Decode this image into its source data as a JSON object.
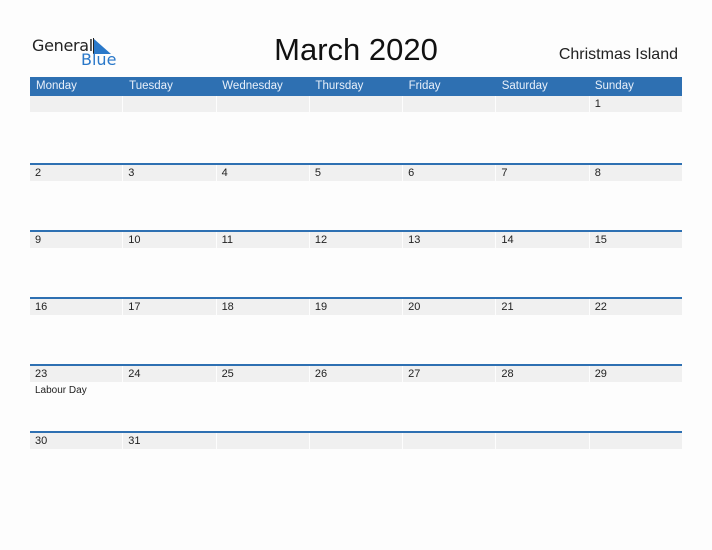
{
  "logo": {
    "line1": "General",
    "line2": "Blue",
    "accent": "#2a78c9"
  },
  "title": "March 2020",
  "country": "Christmas Island",
  "colors": {
    "header_bg": "#2e70b2",
    "band_bg": "#f0f0f0"
  },
  "weekdays": [
    "Monday",
    "Tuesday",
    "Wednesday",
    "Thursday",
    "Friday",
    "Saturday",
    "Sunday"
  ],
  "weeks": [
    {
      "days": [
        {
          "num": "",
          "holiday": ""
        },
        {
          "num": "",
          "holiday": ""
        },
        {
          "num": "",
          "holiday": ""
        },
        {
          "num": "",
          "holiday": ""
        },
        {
          "num": "",
          "holiday": ""
        },
        {
          "num": "",
          "holiday": ""
        },
        {
          "num": "1",
          "holiday": ""
        }
      ]
    },
    {
      "days": [
        {
          "num": "2",
          "holiday": ""
        },
        {
          "num": "3",
          "holiday": ""
        },
        {
          "num": "4",
          "holiday": ""
        },
        {
          "num": "5",
          "holiday": ""
        },
        {
          "num": "6",
          "holiday": ""
        },
        {
          "num": "7",
          "holiday": ""
        },
        {
          "num": "8",
          "holiday": ""
        }
      ]
    },
    {
      "days": [
        {
          "num": "9",
          "holiday": ""
        },
        {
          "num": "10",
          "holiday": ""
        },
        {
          "num": "11",
          "holiday": ""
        },
        {
          "num": "12",
          "holiday": ""
        },
        {
          "num": "13",
          "holiday": ""
        },
        {
          "num": "14",
          "holiday": ""
        },
        {
          "num": "15",
          "holiday": ""
        }
      ]
    },
    {
      "days": [
        {
          "num": "16",
          "holiday": ""
        },
        {
          "num": "17",
          "holiday": ""
        },
        {
          "num": "18",
          "holiday": ""
        },
        {
          "num": "19",
          "holiday": ""
        },
        {
          "num": "20",
          "holiday": ""
        },
        {
          "num": "21",
          "holiday": ""
        },
        {
          "num": "22",
          "holiday": ""
        }
      ]
    },
    {
      "days": [
        {
          "num": "23",
          "holiday": "Labour Day"
        },
        {
          "num": "24",
          "holiday": ""
        },
        {
          "num": "25",
          "holiday": ""
        },
        {
          "num": "26",
          "holiday": ""
        },
        {
          "num": "27",
          "holiday": ""
        },
        {
          "num": "28",
          "holiday": ""
        },
        {
          "num": "29",
          "holiday": ""
        }
      ]
    },
    {
      "days": [
        {
          "num": "30",
          "holiday": ""
        },
        {
          "num": "31",
          "holiday": ""
        },
        {
          "num": "",
          "holiday": ""
        },
        {
          "num": "",
          "holiday": ""
        },
        {
          "num": "",
          "holiday": ""
        },
        {
          "num": "",
          "holiday": ""
        },
        {
          "num": "",
          "holiday": ""
        }
      ]
    }
  ]
}
